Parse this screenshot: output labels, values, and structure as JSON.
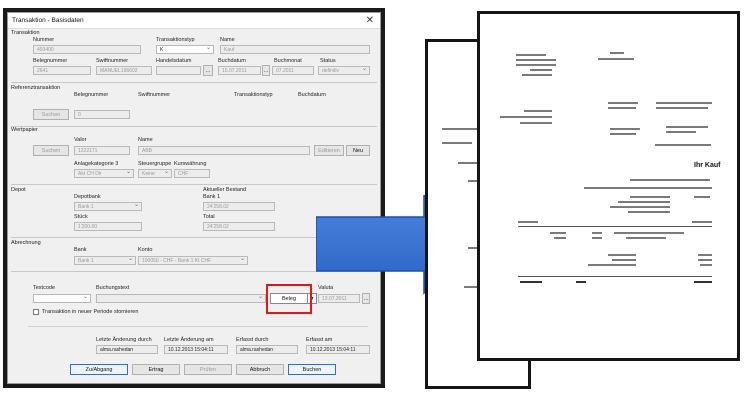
{
  "dialog": {
    "title": "Transaktion - Basisdaten",
    "close_glyph": "✕",
    "sections": {
      "transaktion": "Transaktion",
      "referenztransaktion": "Referenztransaktion",
      "wertpapier": "Wertpapier",
      "depot": "Depot",
      "abrechnung": "Abrechnung"
    },
    "transaktion": {
      "nummer_label": "Nummer",
      "nummer_value": "493400",
      "typ_label": "Transaktionstyp",
      "typ_value": "K",
      "name_label": "Name",
      "name_value": "Kauf",
      "belegnummer_label": "Belegnummer",
      "belegnummer_value": "2641",
      "swift_label": "Swiftnummer",
      "swift_value": "MANUEL196602",
      "handelsdatum_label": "Handelsdatum",
      "buchdatum_label": "Buchdatum",
      "buchdatum_value": "15.07.2011",
      "buchmonat_label": "Buchmonat",
      "buchmonat_value": "07.2011",
      "status_label": "Status",
      "status_value": "definitiv"
    },
    "referenz": {
      "beleg_label": "Belegnummer",
      "beleg_value": "0",
      "swift_label": "Swiftnummer",
      "typ_label": "Transaktionstyp",
      "buchdatum_label": "Buchdatum",
      "suchen": "Suchen"
    },
    "wertpapier": {
      "valor_label": "Valor",
      "valor_value": "1222171",
      "name_label": "Name",
      "name_value": "ABB",
      "anlage_label": "Anlagekategorie 3",
      "anlage_value": "Akt CH Dir",
      "steuer_label": "Steuergruppe",
      "steuer_value": "Keine",
      "kurs_label": "Kurswährung",
      "kurs_value": "CHF",
      "suchen": "Suchen",
      "editieren": "Editieren",
      "neu": "Neu"
    },
    "depot": {
      "depotbank_label": "Depotbank",
      "depotbank_value": "Bank 1",
      "bestand_label": "Aktueller Bestand",
      "bestand_bank": "Bank 1",
      "bestand_value": "24'258.02",
      "stueck_label": "Stück",
      "stueck_value": "1'200.00",
      "total_label": "Total",
      "total_value": "24'258.02"
    },
    "abrechnung": {
      "bank_label": "Bank",
      "bank_value": "Bank 1",
      "konto_label": "Konto",
      "konto_value": "100050 - CHF - Bank 1 Kt CHF"
    },
    "buchung": {
      "textcode_label": "Textcode",
      "buchungstext_label": "Buchungstext",
      "beleg_button": "Beleg",
      "beleg_arrow": "▼",
      "valuta_label": "Valuta",
      "valuta_value": "13.07.2011",
      "checkbox_label": "Transaktion in neuer Periode stornieren"
    },
    "audit": {
      "letzte_durch_label": "Letzte Änderung durch",
      "letzte_durch_value": "alma.rashedan",
      "letzte_am_label": "Letzte Änderung am",
      "letzte_am_value": "10.12.2013 15:04:11",
      "erfasst_durch_label": "Erfasst durch",
      "erfasst_durch_value": "alma.rashedan",
      "erfasst_am_label": "Erfasst am",
      "erfasst_am_value": "10.12.2013 15:04:11"
    },
    "footer": {
      "zu_abgang": "Zu/Abgang",
      "ertrag": "Ertrag",
      "pruefen": "Prüfen",
      "abbruch": "Abbruch",
      "buchen": "Buchen"
    }
  },
  "colors": {
    "highlight": "#e01818",
    "arrow": "#2e6fd0",
    "dialog_bg": "#f0f0f0"
  },
  "document": {
    "heading": "Ihr Kauf"
  }
}
